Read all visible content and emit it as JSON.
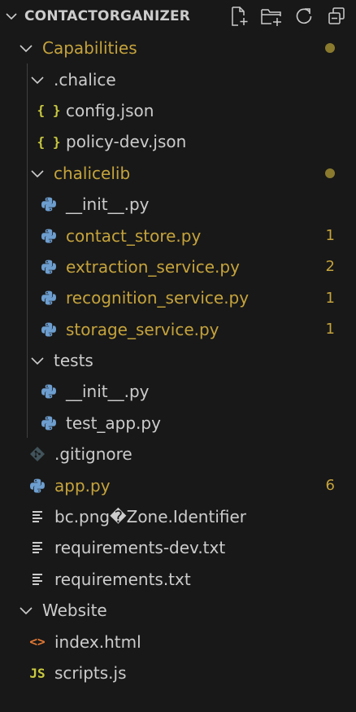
{
  "explorer": {
    "title": "CONTACTORGANIZER",
    "actions": [
      {
        "name": "new-file",
        "icon": "new-file-icon"
      },
      {
        "name": "new-folder",
        "icon": "new-folder-icon"
      },
      {
        "name": "refresh",
        "icon": "refresh-icon"
      },
      {
        "name": "collapse-all",
        "icon": "collapse-all-icon"
      }
    ]
  },
  "colors": {
    "background": "#181818",
    "text": "#cccccc",
    "modified": "#c5a33c",
    "python_blue": "#6d9ecf",
    "json_yellow": "#cbcb41",
    "html_orange": "#e37933"
  },
  "tree": [
    {
      "label": "Capabilities",
      "type": "folder",
      "expanded": true,
      "modified": true,
      "decoration": "dot"
    },
    {
      "label": ".chalice",
      "type": "folder",
      "expanded": true,
      "modified": false
    },
    {
      "label": "config.json",
      "type": "json",
      "icon_text": "{ }",
      "modified": false
    },
    {
      "label": "policy-dev.json",
      "type": "json",
      "icon_text": "{ }",
      "modified": false
    },
    {
      "label": "chalicelib",
      "type": "folder",
      "expanded": true,
      "modified": true,
      "decoration": "dot"
    },
    {
      "label": "__init__.py",
      "type": "python",
      "modified": false
    },
    {
      "label": "contact_store.py",
      "type": "python",
      "modified": true,
      "badge": "1"
    },
    {
      "label": "extraction_service.py",
      "type": "python",
      "modified": true,
      "badge": "2"
    },
    {
      "label": "recognition_service.py",
      "type": "python",
      "modified": true,
      "badge": "1"
    },
    {
      "label": "storage_service.py",
      "type": "python",
      "modified": true,
      "badge": "1"
    },
    {
      "label": "tests",
      "type": "folder",
      "expanded": true,
      "modified": false
    },
    {
      "label": "__init__.py",
      "type": "python",
      "modified": false
    },
    {
      "label": "test_app.py",
      "type": "python",
      "modified": false
    },
    {
      "label": ".gitignore",
      "type": "git",
      "modified": false
    },
    {
      "label": "app.py",
      "type": "python",
      "modified": true,
      "badge": "6"
    },
    {
      "label": "bc.png�Zone.Identifier",
      "type": "text",
      "modified": false
    },
    {
      "label": "requirements-dev.txt",
      "type": "text",
      "modified": false
    },
    {
      "label": "requirements.txt",
      "type": "text",
      "modified": false
    },
    {
      "label": "Website",
      "type": "folder",
      "expanded": true,
      "modified": false
    },
    {
      "label": "index.html",
      "type": "html",
      "icon_text": "<>",
      "modified": false
    },
    {
      "label": "scripts.js",
      "type": "js",
      "icon_text": "JS",
      "modified": false
    }
  ]
}
